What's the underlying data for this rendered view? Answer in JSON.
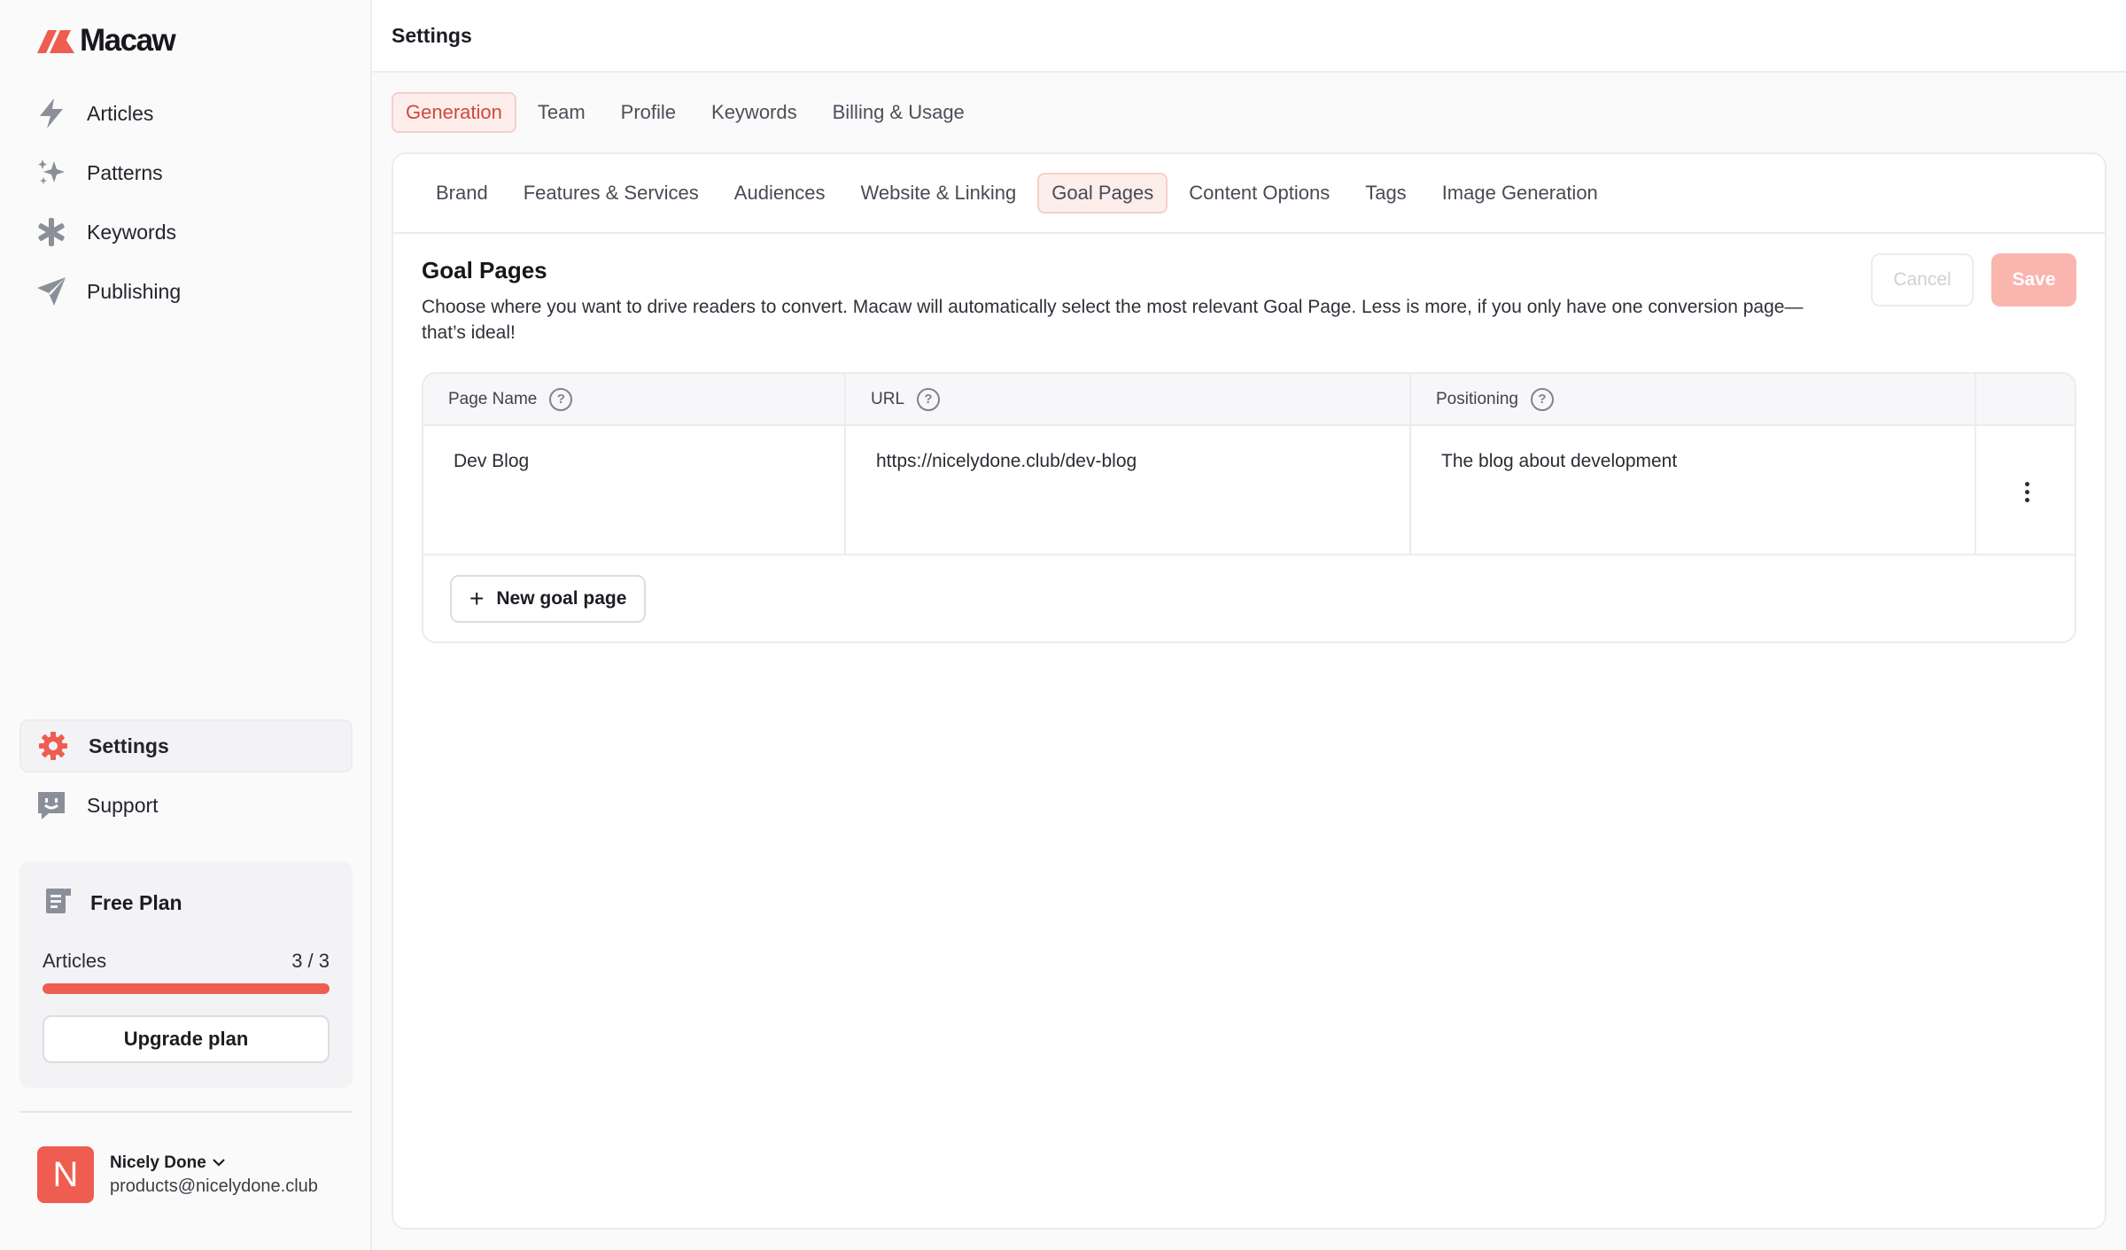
{
  "brand": {
    "name": "Macaw",
    "accent": "#ee5d4f"
  },
  "sidebar": {
    "nav": [
      {
        "label": "Articles",
        "icon": "lightning-icon"
      },
      {
        "label": "Patterns",
        "icon": "sparkles-icon"
      },
      {
        "label": "Keywords",
        "icon": "asterisk-icon"
      },
      {
        "label": "Publishing",
        "icon": "send-icon"
      }
    ],
    "bottom_nav": [
      {
        "label": "Settings",
        "icon": "gear-icon",
        "active": true
      },
      {
        "label": "Support",
        "icon": "support-face-icon"
      }
    ],
    "plan": {
      "title": "Free Plan",
      "metric_label": "Articles",
      "metric_value": "3 / 3",
      "progress": 1.0,
      "upgrade_label": "Upgrade plan"
    },
    "user": {
      "initial": "N",
      "name": "Nicely Done",
      "email": "products@nicelydone.club"
    }
  },
  "header": {
    "title": "Settings"
  },
  "tabs": [
    "Generation",
    "Team",
    "Profile",
    "Keywords",
    "Billing & Usage"
  ],
  "active_tab": "Generation",
  "subtabs": [
    "Brand",
    "Features & Services",
    "Audiences",
    "Website & Linking",
    "Goal Pages",
    "Content Options",
    "Tags",
    "Image Generation"
  ],
  "active_subtab": "Goal Pages",
  "section": {
    "title": "Goal Pages",
    "description": "Choose where you want to drive readers to convert. Macaw will automatically select the most relevant Goal Page. Less is more, if you only have one conversion page—that’s ideal!",
    "cancel_label": "Cancel",
    "save_label": "Save"
  },
  "table": {
    "columns": [
      "Page Name",
      "URL",
      "Positioning"
    ],
    "rows": [
      {
        "page_name": "Dev Blog",
        "url": "https://nicelydone.club/dev-blog",
        "positioning": "The blog about development"
      }
    ],
    "new_label": "New goal page"
  }
}
